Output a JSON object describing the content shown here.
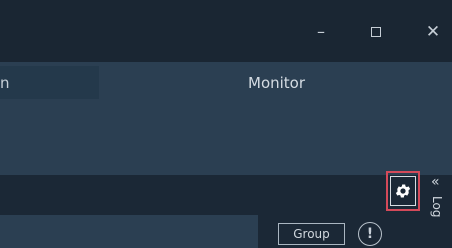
{
  "window": {
    "controls": {
      "minimize": "–",
      "close": "✕"
    }
  },
  "tabs": [
    {
      "label": "n"
    },
    {
      "label": "Monitor"
    }
  ],
  "toolbar": {
    "settings_icon": "gear-icon"
  },
  "side_panel": {
    "chevron": "«",
    "label": "Log"
  },
  "actions": {
    "group_label": "Group",
    "alert_symbol": "!"
  },
  "colors": {
    "title_bar": "#1a2633",
    "panel": "#2b3f52",
    "dark_strip": "#1b2836",
    "highlight": "#d44a5a"
  }
}
